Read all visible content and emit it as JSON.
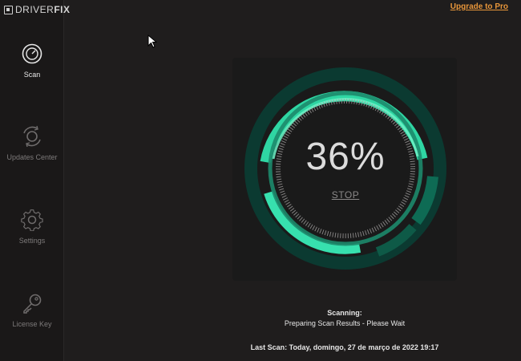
{
  "app": {
    "brand_light": "DRIVER",
    "brand_bold": "FIX",
    "upgrade_label": "Upgrade to Pro",
    "accent_color": "#2fd6a3",
    "link_color": "#e8963a"
  },
  "sidebar": {
    "items": [
      {
        "label": "Scan",
        "icon": "scan-icon",
        "active": true
      },
      {
        "label": "Updates Center",
        "icon": "refresh-icon",
        "active": false
      },
      {
        "label": "Settings",
        "icon": "gear-icon",
        "active": false
      },
      {
        "label": "License Key",
        "icon": "key-icon",
        "active": false
      }
    ]
  },
  "scan": {
    "progress_text": "36%",
    "progress": 0.36,
    "stop_label": "STOP",
    "status_title": "Scanning:",
    "status_detail": "Preparing Scan Results - Please Wait",
    "last_scan": "Last Scan: Today, domingo, 27 de março de 2022 19:17"
  }
}
